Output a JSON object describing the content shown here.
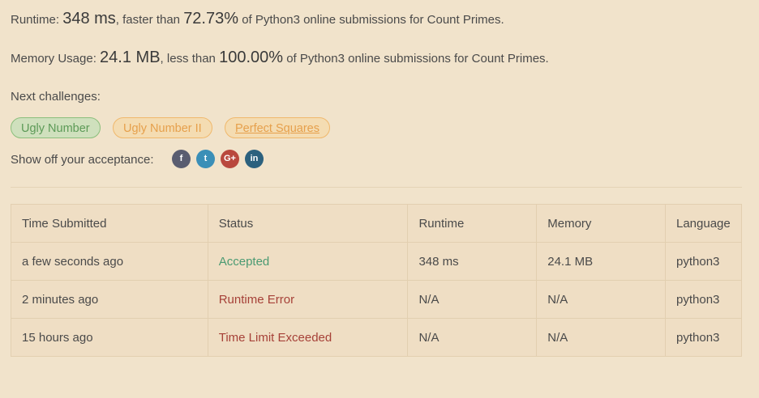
{
  "result": {
    "runtime_label": "Runtime: ",
    "runtime_value": "348 ms",
    "runtime_mid": ", faster than ",
    "runtime_pct": "72.73%",
    "runtime_tail": " of Python3 online submissions for Count Primes.",
    "memory_label": "Memory Usage: ",
    "memory_value": "24.1 MB",
    "memory_mid": ", less than ",
    "memory_pct": "100.00%",
    "memory_tail": " of Python3 online submissions for Count Primes."
  },
  "next": {
    "label": "Next challenges:",
    "challenges": [
      "Ugly Number",
      "Ugly Number II",
      "Perfect Squares"
    ]
  },
  "share": {
    "label": "Show off your acceptance:",
    "icons": [
      "facebook-icon",
      "twitter-icon",
      "google-plus-icon",
      "linkedin-icon"
    ],
    "glyphs": [
      "f",
      "t",
      "G+",
      "in"
    ]
  },
  "table": {
    "headers": [
      "Time Submitted",
      "Status",
      "Runtime",
      "Memory",
      "Language"
    ],
    "rows": [
      [
        "a few seconds ago",
        "Accepted",
        "348 ms",
        "24.1 MB",
        "python3"
      ],
      [
        "2 minutes ago",
        "Runtime Error",
        "N/A",
        "N/A",
        "python3"
      ],
      [
        "15 hours ago",
        "Time Limit Exceeded",
        "N/A",
        "N/A",
        "python3"
      ]
    ]
  },
  "colors": {
    "background": "#f1e3cb",
    "accepted": "#4a9a72",
    "error": "#a64138",
    "easy": "#5c9a57",
    "medium": "#e6a04c"
  }
}
